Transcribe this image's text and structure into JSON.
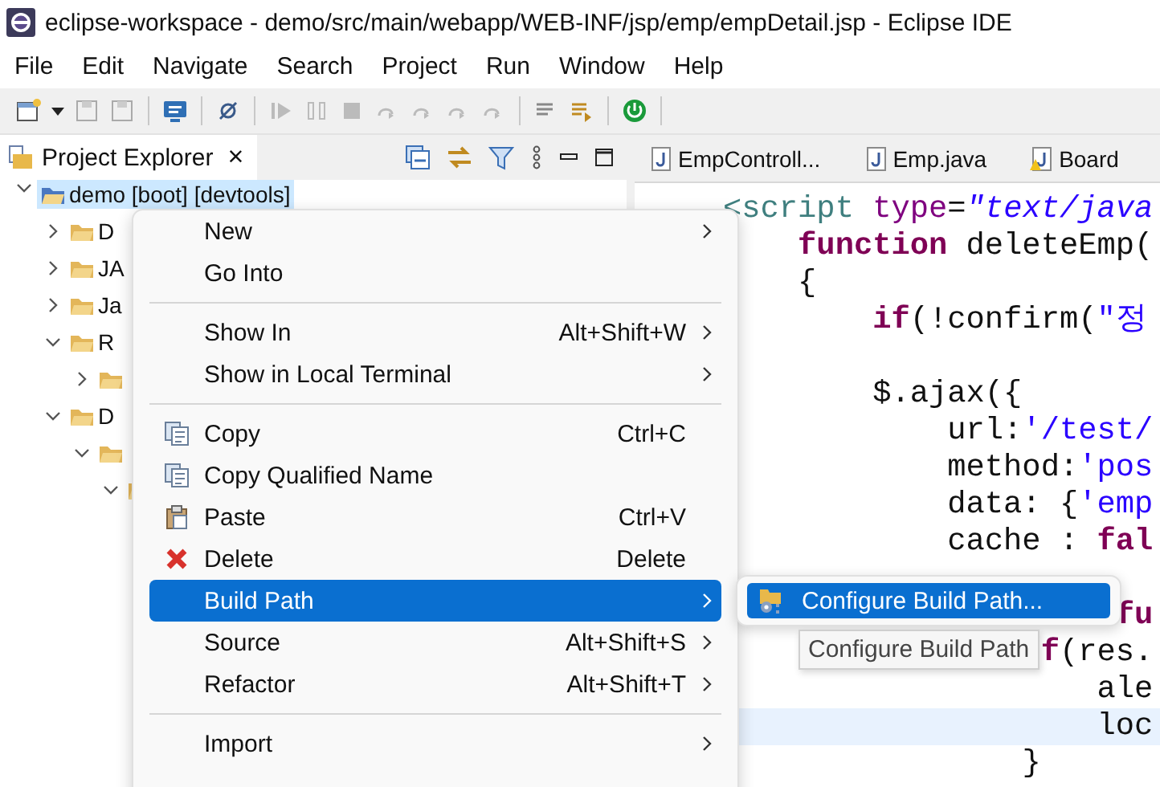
{
  "window": {
    "title": "eclipse-workspace - demo/src/main/webapp/WEB-INF/jsp/emp/empDetail.jsp - Eclipse IDE"
  },
  "menu_bar": [
    "File",
    "Edit",
    "Navigate",
    "Search",
    "Project",
    "Run",
    "Window",
    "Help"
  ],
  "project_explorer": {
    "title": "Project Explorer",
    "close": "×",
    "tree": [
      {
        "label": "demo [boot] [devtools]",
        "expanded": true,
        "selected": true,
        "children": [
          {
            "label": "D",
            "expanded": false,
            "selected": false
          },
          {
            "label": "JA",
            "expanded": false,
            "selected": false
          },
          {
            "label": "Ja",
            "expanded": false,
            "selected": false
          },
          {
            "label": "R",
            "expanded": true,
            "selected": false,
            "children": [
              {
                "expanded": false,
                "selected": false
              }
            ]
          },
          {
            "label": "D",
            "expanded": true,
            "selected": false,
            "children": [
              {
                "expanded": true,
                "selected": false,
                "children": [
                  {
                    "expanded": true,
                    "selected": false
                  }
                ]
              }
            ]
          }
        ]
      }
    ]
  },
  "editor": {
    "tabs": [
      {
        "label": "EmpControll...",
        "warning": false
      },
      {
        "label": "Emp.java",
        "warning": false
      },
      {
        "label": "Board",
        "warning": true
      }
    ],
    "lines": [
      {
        "current": false,
        "tokens": [
          {
            "text": "<script",
            "kind": "tag"
          },
          {
            "text": " type",
            "kind": "attribute"
          },
          {
            "text": "=",
            "kind": "plain"
          },
          {
            "text": "\"text/java",
            "kind": "value"
          }
        ]
      },
      {
        "current": false,
        "tokens": [
          {
            "text": "    function",
            "kind": "keyword"
          },
          {
            "text": " deleteEmp(",
            "kind": "plain"
          }
        ]
      },
      {
        "current": false,
        "tokens": [
          {
            "text": "    {",
            "kind": "plain"
          }
        ]
      },
      {
        "current": false,
        "tokens": [
          {
            "text": "        if",
            "kind": "keyword"
          },
          {
            "text": "(!confirm(",
            "kind": "plain"
          },
          {
            "text": "\"정",
            "kind": "string"
          }
        ]
      },
      {
        "current": false
      },
      {
        "current": false,
        "tokens": [
          {
            "text": "        $.ajax({",
            "kind": "plain"
          }
        ]
      },
      {
        "current": false,
        "tokens": [
          {
            "text": "            url:",
            "kind": "plain"
          },
          {
            "text": "'/test/",
            "kind": "string"
          }
        ]
      },
      {
        "current": false,
        "tokens": [
          {
            "text": "            method:",
            "kind": "plain"
          },
          {
            "text": "'pos",
            "kind": "string"
          }
        ]
      },
      {
        "current": false,
        "tokens": [
          {
            "text": "            data: {",
            "kind": "plain"
          },
          {
            "text": "'emp",
            "kind": "string"
          }
        ]
      },
      {
        "current": false,
        "tokens": [
          {
            "text": "            cache : ",
            "kind": "plain"
          },
          {
            "text": "fal",
            "kind": "keyword"
          }
        ]
      },
      {
        "current": false
      },
      {
        "current": false,
        "tokens": [
          {
            "text": "                     fu",
            "kind": "keyword"
          }
        ]
      },
      {
        "current": false,
        "tokens": [
          {
            "text": "                 f",
            "kind": "keyword"
          },
          {
            "text": "(res.",
            "kind": "plain"
          }
        ]
      },
      {
        "current": false,
        "tokens": [
          {
            "text": "                    ale",
            "kind": "plain"
          }
        ]
      },
      {
        "current": true,
        "tokens": [
          {
            "text": "                    loc",
            "kind": "plain"
          }
        ]
      },
      {
        "current": false,
        "tokens": [
          {
            "text": "                }",
            "kind": "plain"
          }
        ]
      }
    ]
  },
  "context_menu": {
    "items": [
      {
        "kind": "plain",
        "label": "New",
        "submenu": true,
        "selected": false
      },
      {
        "kind": "plain",
        "label": "Go Into",
        "submenu": false,
        "selected": false
      },
      {
        "kind": "separator"
      },
      {
        "kind": "plain",
        "label": "Show In",
        "shortcut": "Alt+Shift+W",
        "submenu": true,
        "selected": false
      },
      {
        "kind": "plain",
        "label": "Show in Local Terminal",
        "submenu": true,
        "selected": false
      },
      {
        "kind": "separator"
      },
      {
        "kind": "copy",
        "label": "Copy",
        "shortcut": "Ctrl+C",
        "submenu": false,
        "selected": false
      },
      {
        "kind": "copy-qualified",
        "label": "Copy Qualified Name",
        "submenu": false,
        "selected": false
      },
      {
        "kind": "paste",
        "label": "Paste",
        "shortcut": "Ctrl+V",
        "submenu": false,
        "selected": false
      },
      {
        "kind": "delete",
        "label": "Delete",
        "shortcut": "Delete",
        "submenu": false,
        "selected": false
      },
      {
        "kind": "plain",
        "label": "Build Path",
        "submenu": true,
        "selected": true
      },
      {
        "kind": "plain",
        "label": "Source",
        "shortcut": "Alt+Shift+S",
        "submenu": true,
        "selected": false
      },
      {
        "kind": "plain",
        "label": "Refactor",
        "shortcut": "Alt+Shift+T",
        "submenu": true,
        "selected": false
      },
      {
        "kind": "separator"
      },
      {
        "kind": "plain",
        "label": "Import",
        "submenu": true,
        "selected": false
      }
    ]
  },
  "submenu": {
    "items": [
      {
        "label": "Configure Build Path...",
        "selected": true
      }
    ]
  },
  "tooltip": "Configure Build Path"
}
